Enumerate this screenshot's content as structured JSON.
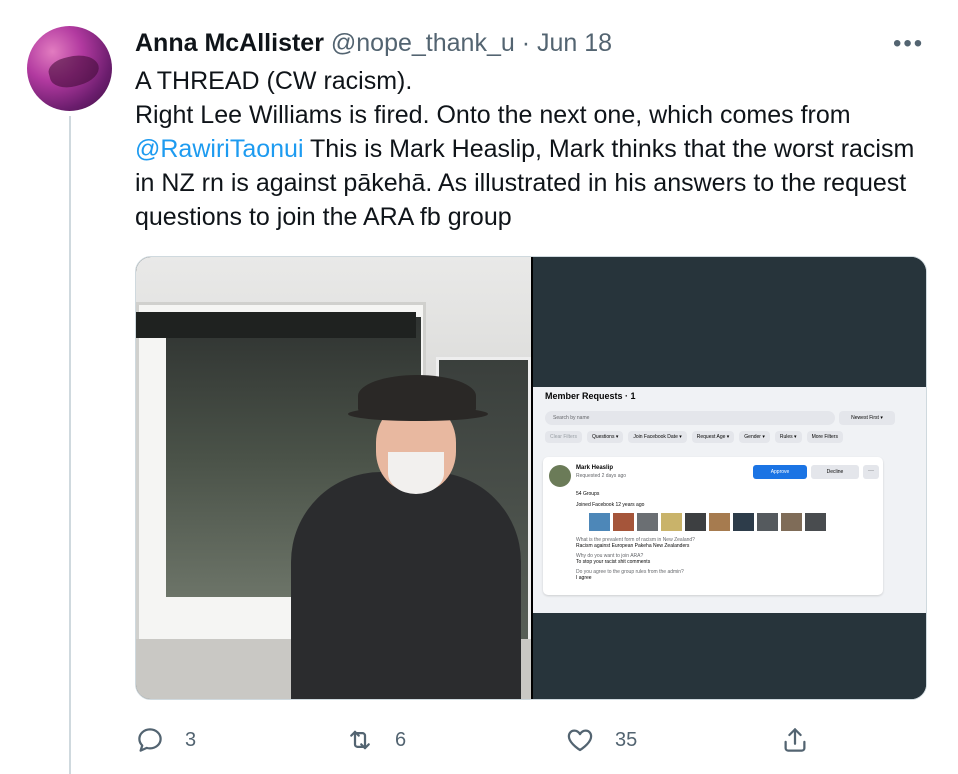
{
  "tweet": {
    "display_name": "Anna McAllister",
    "handle": "@nope_thank_u",
    "separator": "·",
    "date": "Jun 18",
    "more_label": "•••",
    "text": {
      "line1": "A THREAD (CW racism).",
      "line2_before": "Right Lee Williams is fired. Onto the next one, which comes from ",
      "mention": "@RawiriTaonui",
      "line2_after": " This is Mark Heaslip, Mark thinks that the worst racism in NZ rn is against pākehā. As illustrated in his answers to the request questions   to join the ARA fb group"
    }
  },
  "media": {
    "fb_screenshot": {
      "title": "Member Requests · 1",
      "search_placeholder": "Search by name",
      "sort": "Newest First ▾",
      "filters": [
        "Clear Filters",
        "Questions ▾",
        "Join Facebook Date ▾",
        "Request Age ▾",
        "Gender ▾",
        "Rules ▾",
        "More Filters"
      ],
      "member_name": "Mark Heaslip",
      "requested": "Requested 2 days ago",
      "approve": "Approve",
      "decline": "Decline",
      "more": "···",
      "groups": "54 Groups",
      "joined": "Joined Facebook 12 years ago",
      "q1": "What is the prevalent form of racism in New Zealand?",
      "a1": "Racism against European Pakeha New Zealanders",
      "q2": "Why do you want to join ARA?",
      "a2": "To stop your racist shit comments",
      "q3": "Do you agree to the group rules from the admin?",
      "a3": "I agree"
    }
  },
  "actions": {
    "reply_count": "3",
    "retweet_count": "6",
    "like_count": "35"
  },
  "icons": {
    "reply": "reply-icon",
    "retweet": "retweet-icon",
    "like": "heart-icon",
    "share": "share-icon"
  }
}
